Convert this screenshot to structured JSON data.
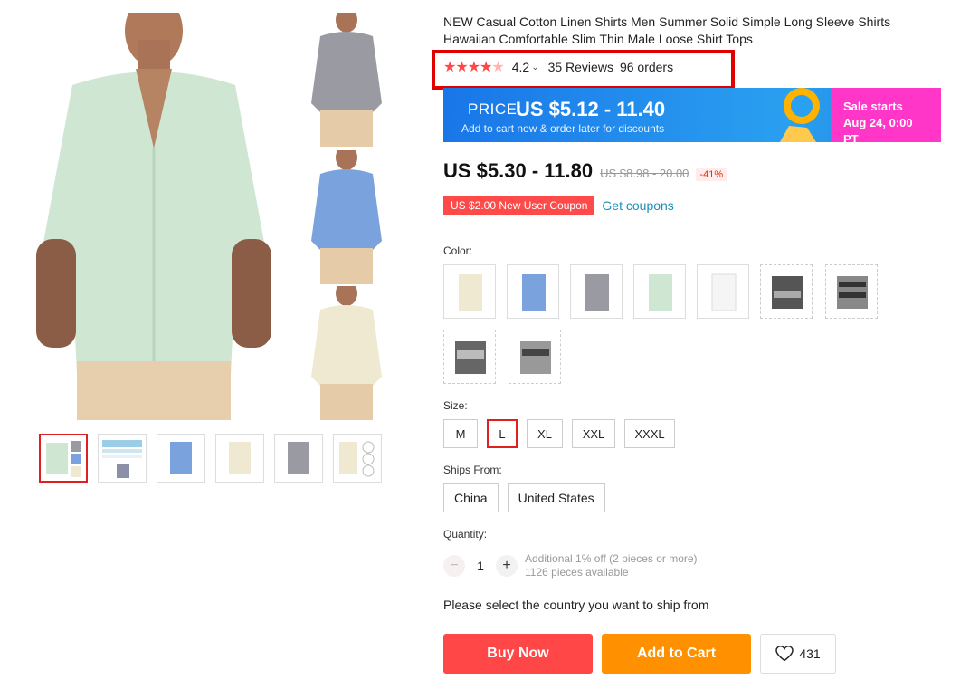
{
  "product": {
    "title": "NEW Casual Cotton Linen Shirts Men Summer Solid Simple Long Sleeve Shirts Hawaiian Comfortable Slim Thin Male Loose Shirt Tops",
    "rating_stars": "★★★★",
    "rating_half": "★",
    "rating_score": "4.2",
    "reviews": "35 Reviews",
    "orders": "96 orders"
  },
  "banner": {
    "label": "PRICE:",
    "price": "US $5.12 - 11.40",
    "sub": "Add to cart now & order later for discounts",
    "sale_line1": "Sale starts",
    "sale_line2": "Aug 24, 0:00 PT"
  },
  "price": {
    "current": "US $5.30 - 11.80",
    "original": "US $8.98 - 20.00",
    "discount": "-41%"
  },
  "coupon": {
    "tag": "US $2.00 New User Coupon",
    "link": "Get coupons"
  },
  "color": {
    "label": "Color:",
    "swatches": [
      "beige",
      "blue",
      "gray",
      "mint",
      "white",
      "print-1",
      "print-2",
      "print-3",
      "print-4"
    ]
  },
  "size": {
    "label": "Size:",
    "options": [
      "M",
      "L",
      "XL",
      "XXL",
      "XXXL"
    ],
    "selected": "L"
  },
  "ships_from": {
    "label": "Ships From:",
    "options": [
      "China",
      "United States"
    ]
  },
  "quantity": {
    "label": "Quantity:",
    "value": "1",
    "minus": "−",
    "plus": "+",
    "note1": "Additional 1% off (2 pieces or more)",
    "note2": "1126 pieces available"
  },
  "ship_message": "Please select the country you want to ship from",
  "actions": {
    "buy": "Buy Now",
    "cart": "Add to Cart",
    "wishlist_count": "431"
  },
  "colors": {
    "accent_red": "#ff4747",
    "orange": "#ff9000",
    "banner_blue": "#1976e8",
    "sale_pink": "#ff36c7"
  }
}
